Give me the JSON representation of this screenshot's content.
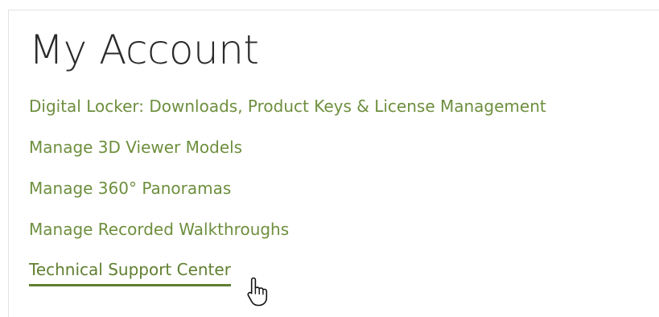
{
  "section": {
    "title": "My Account"
  },
  "links": [
    {
      "label": "Digital Locker: Downloads, Product Keys & License Management"
    },
    {
      "label": "Manage 3D Viewer Models"
    },
    {
      "label": "Manage 360° Panoramas"
    },
    {
      "label": "Manage Recorded Walkthroughs"
    },
    {
      "label": "Technical Support Center",
      "state": "hovered"
    }
  ],
  "colors": {
    "link": "#6e8f3e",
    "link_hover": "#5f7f30",
    "title": "#2b2b2b",
    "border": "#e3e3e3"
  },
  "cursor": {
    "icon": "hand-pointer-icon"
  }
}
